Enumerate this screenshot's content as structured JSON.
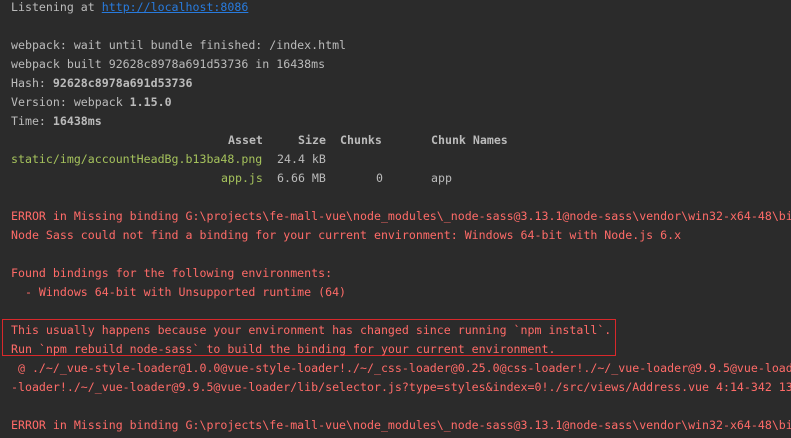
{
  "console": {
    "listen_prefix": "Listening at ",
    "listen_url": "http://localhost:8086",
    "wait_line": "webpack: wait until bundle finished: /index.html",
    "built_line": "webpack built 92628c8978a691d53736 in 16438ms",
    "hash_label": "Hash: ",
    "hash_value": "92628c8978a691d53736",
    "version_label": "Version: webpack ",
    "version_value": "1.15.0",
    "time_label": "Time: ",
    "time_value": "16438ms",
    "asset_table": {
      "headers": {
        "asset": "Asset",
        "size": "Size",
        "chunks": "Chunks",
        "chunk_names": "Chunk Names"
      },
      "rows": [
        {
          "asset": "static/img/accountHeadBg.b13ba48.png",
          "size": "24.4 kB",
          "chunks": "",
          "chunk_names": ""
        },
        {
          "asset": "app.js",
          "size": "6.66 MB",
          "chunks": "0",
          "chunk_names": "app"
        }
      ]
    },
    "error1": "ERROR in Missing binding G:\\projects\\fe-mall-vue\\node_modules\\_node-sass@3.13.1@node-sass\\vendor\\win32-x64-48\\bi",
    "error_detail": "Node Sass could not find a binding for your current environment: Windows 64-bit with Node.js 6.x",
    "found_bindings": "Found bindings for the following environments:",
    "binding_item": "  - Windows 64-bit with Unsupported runtime (64)",
    "hint_line1": "This usually happens because your environment has changed since running `npm install`.",
    "hint_line2": "Run `npm rebuild node-sass` to build the binding for your current environment.",
    "loader_line1": " @ ./~/_vue-style-loader@1.0.0@vue-style-loader!./~/_css-loader@0.25.0@css-loader!./~/_vue-loader@9.9.5@vue-load",
    "loader_line2": "-loader!./~/_vue-loader@9.9.5@vue-loader/lib/selector.js?type=styles&index=0!./src/views/Address.vue 4:14-342 13",
    "error2": "ERROR in Missing binding G:\\projects\\fe-mall-vue\\node_modules\\_node-sass@3.13.1@node-sass\\vendor\\win32-x64-48\\bi"
  },
  "colors": {
    "background": "#2b2b2b",
    "text": "#bbbbbb",
    "link": "#287bde",
    "asset_green": "#a5c25c",
    "error_red": "#ff6b68",
    "box_border": "#d9282b"
  }
}
